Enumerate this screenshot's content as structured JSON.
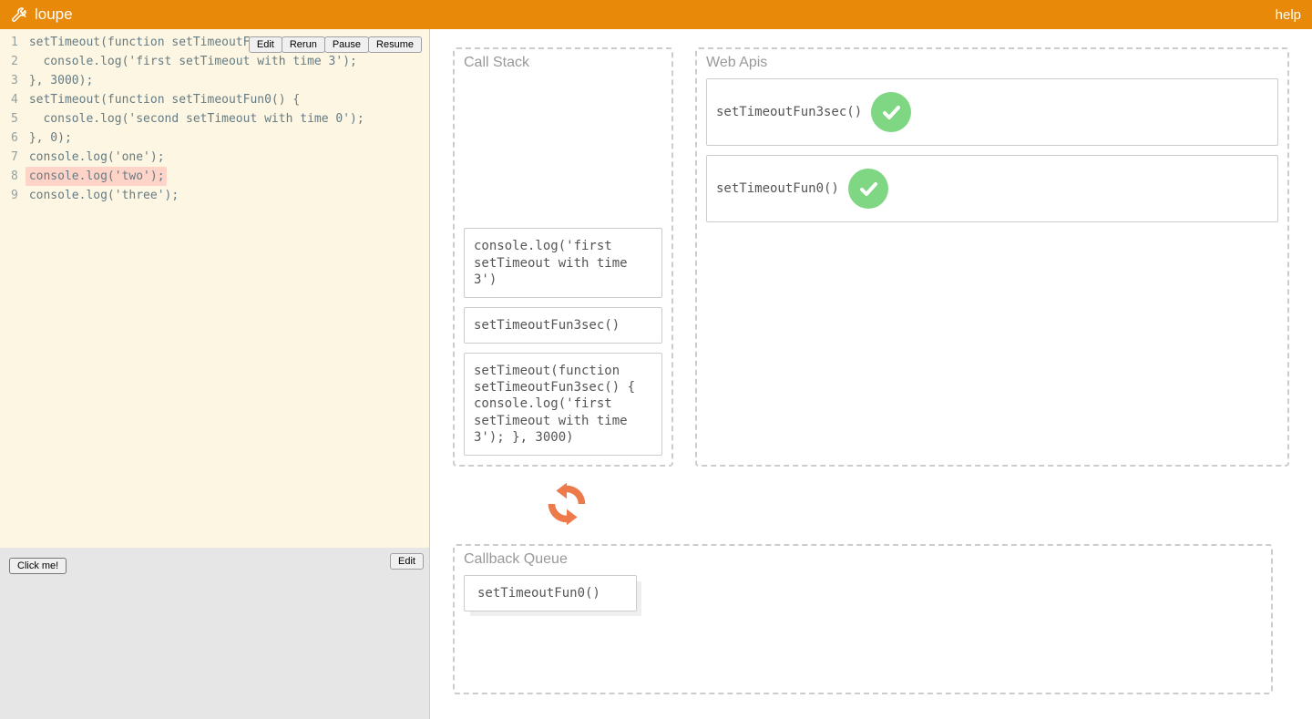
{
  "header": {
    "title": "loupe",
    "help": "help"
  },
  "controls": {
    "edit": "Edit",
    "rerun": "Rerun",
    "pause": "Pause",
    "resume": "Resume"
  },
  "editor": {
    "highlighted_line": 8,
    "lines": [
      "setTimeout(function setTimeoutFun3sec() {",
      "  console.log('first setTimeout with time 3');",
      "}, 3000);",
      "setTimeout(function setTimeoutFun0() {",
      "  console.log('second setTimeout with time 0');",
      "}, 0);",
      "console.log('one');",
      "console.log('two');",
      "console.log('three');"
    ]
  },
  "render": {
    "edit": "Edit",
    "button": "Click me!"
  },
  "panels": {
    "call_stack": {
      "title": "Call Stack",
      "items": [
        "console.log('first setTimeout with time 3')",
        "setTimeoutFun3sec()",
        "setTimeout(function setTimeoutFun3sec() { console.log('first setTimeout with time 3'); }, 3000)"
      ]
    },
    "web_apis": {
      "title": "Web Apis",
      "items": [
        "setTimeoutFun3sec()",
        "setTimeoutFun0()"
      ]
    },
    "callback_queue": {
      "title": "Callback Queue",
      "items": [
        "setTimeoutFun0()"
      ]
    }
  }
}
